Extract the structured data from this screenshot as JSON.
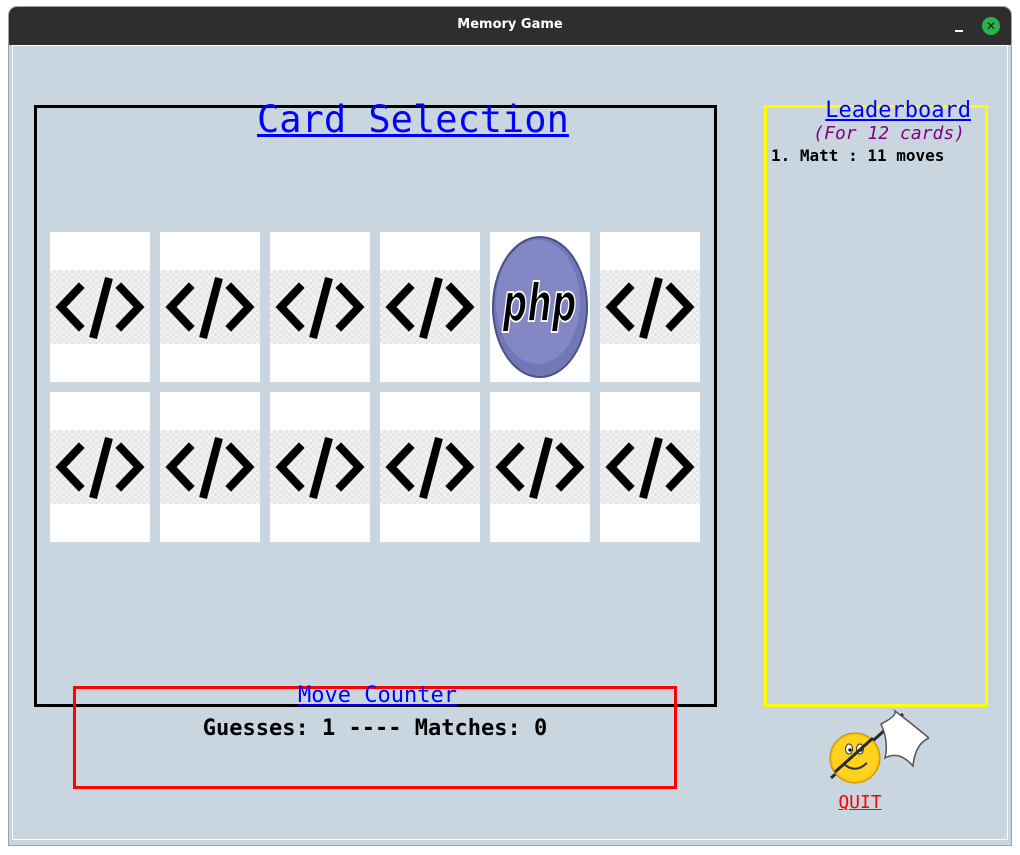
{
  "window": {
    "title": "Memory Game"
  },
  "card_selection": {
    "title": "Card Selection",
    "rows": [
      [
        "code-icon",
        "code-icon",
        "code-icon",
        "code-icon",
        "php-logo",
        "code-icon"
      ],
      [
        "code-icon",
        "code-icon",
        "code-icon",
        "code-icon",
        "code-icon",
        "code-icon"
      ]
    ]
  },
  "leaderboard": {
    "title": "Leaderboard",
    "subtitle": "(For 12 cards)",
    "entries": [
      "1. Matt : 11 moves"
    ]
  },
  "move_counter": {
    "title": "Move Counter",
    "guesses_label": "Guesses:",
    "guesses": "1",
    "separator": "----",
    "matches_label": "Matches:",
    "matches": "0"
  },
  "quit": {
    "label": "QUIT",
    "icon": "white-flag-smiley-icon"
  },
  "colors": {
    "card_panel_border": "#000000",
    "leaderboard_border": "#ffff00",
    "move_counter_border": "#ff0000",
    "link_blue": "#0000ff",
    "subtitle_purple": "#800080",
    "quit_red": "#ff0000",
    "background": "#c9d6e0"
  }
}
